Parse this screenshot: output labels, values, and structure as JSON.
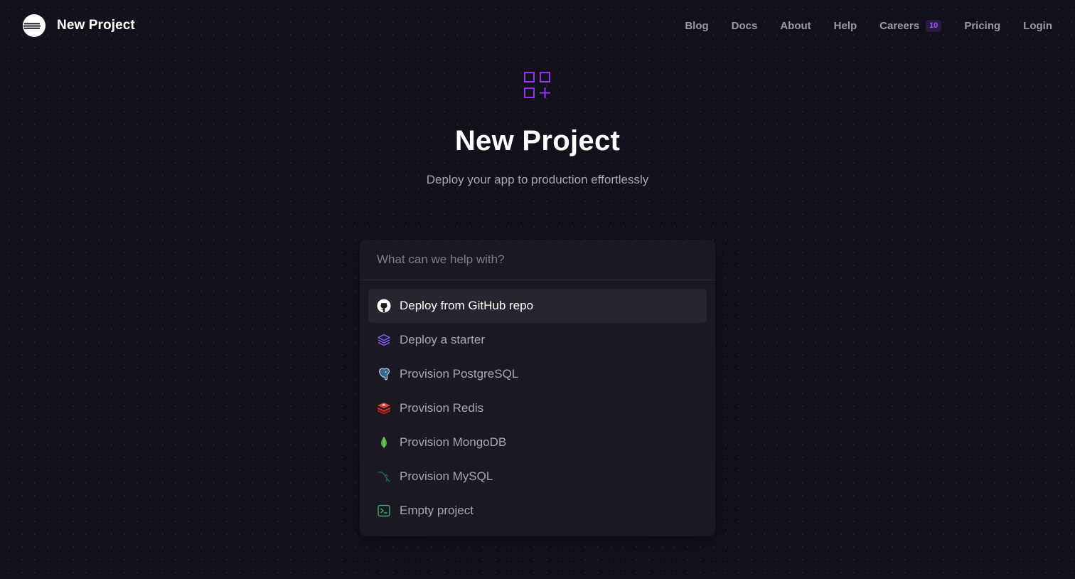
{
  "header": {
    "brand": "New Project",
    "nav": [
      {
        "label": "Blog"
      },
      {
        "label": "Docs"
      },
      {
        "label": "About"
      },
      {
        "label": "Help"
      },
      {
        "label": "Careers",
        "badge": "10"
      },
      {
        "label": "Pricing"
      },
      {
        "label": "Login"
      }
    ]
  },
  "hero": {
    "icon": "grid-plus-icon",
    "title": "New Project",
    "subtitle": "Deploy your app to production effortlessly"
  },
  "panel": {
    "search_placeholder": "What can we help with?",
    "search_value": "",
    "options": [
      {
        "label": "Deploy from GitHub repo",
        "icon": "github-icon",
        "active": true
      },
      {
        "label": "Deploy a starter",
        "icon": "layers-icon",
        "active": false
      },
      {
        "label": "Provision PostgreSQL",
        "icon": "postgresql-icon",
        "active": false
      },
      {
        "label": "Provision Redis",
        "icon": "redis-icon",
        "active": false
      },
      {
        "label": "Provision MongoDB",
        "icon": "mongodb-icon",
        "active": false
      },
      {
        "label": "Provision MySQL",
        "icon": "mysql-icon",
        "active": false
      },
      {
        "label": "Empty project",
        "icon": "terminal-icon",
        "active": false
      }
    ]
  },
  "colors": {
    "background": "#13111c",
    "accent": "#a855f7",
    "panel": "#1b1a23",
    "active_row": "#262530"
  }
}
